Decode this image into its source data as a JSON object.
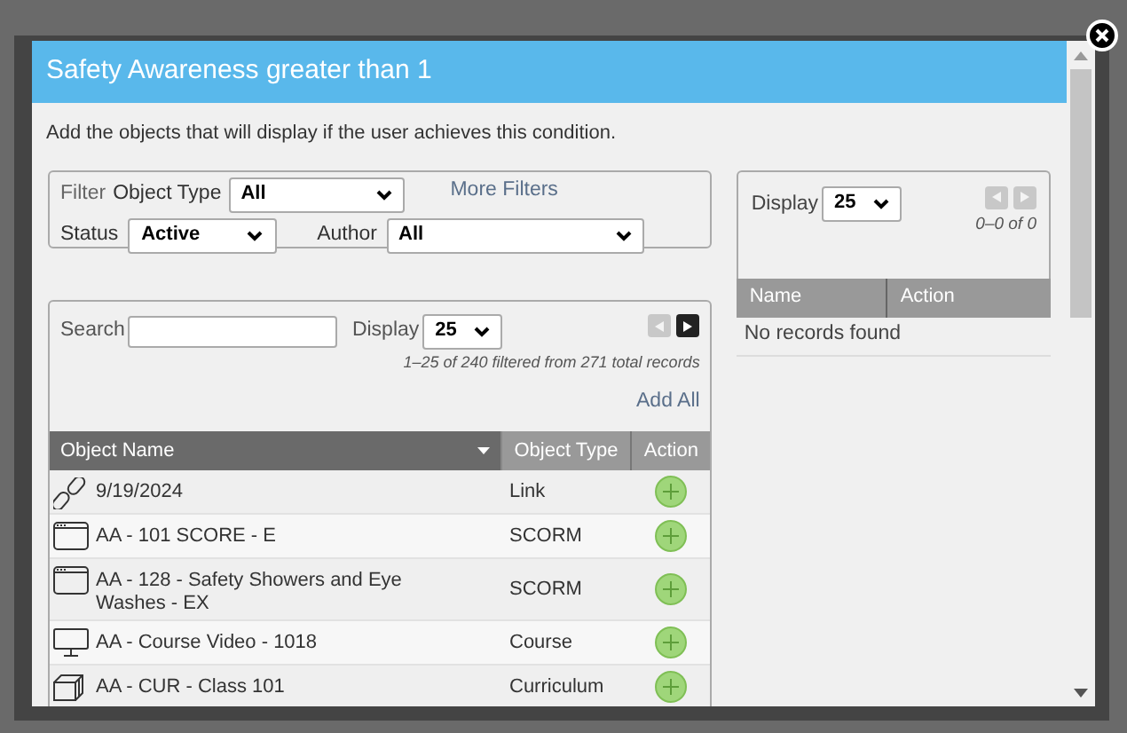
{
  "dialog": {
    "title": "Safety Awareness greater than 1",
    "description": "Add the objects that will display if the user achieves this condition."
  },
  "filters": {
    "label": "Filter",
    "object_type": {
      "label": "Object Type",
      "value": "All"
    },
    "more_filters": "More Filters",
    "status": {
      "label": "Status",
      "value": "Active"
    },
    "author": {
      "label": "Author",
      "value": "All"
    }
  },
  "available": {
    "search": {
      "label": "Search"
    },
    "display": {
      "label": "Display",
      "value": "25"
    },
    "pager": [
      {
        "kind": "prev",
        "disabled": true
      },
      {
        "kind": "next",
        "disabled": false
      }
    ],
    "summary": "1–25 of 240 filtered from 271 total records",
    "add_all": "Add All",
    "columns": [
      "Object Name",
      "Object Type",
      "Action"
    ],
    "rows": [
      {
        "kind": "link",
        "name": "9/19/2024",
        "type": "Link"
      },
      {
        "kind": "scorm",
        "name": "AA - 101 SCORE - E",
        "type": "SCORM"
      },
      {
        "kind": "scorm",
        "name": "AA - 128 - Safety Showers and Eye Washes - EX",
        "type": "SCORM"
      },
      {
        "kind": "course",
        "name": "AA - Course Video - 1018",
        "type": "Course"
      },
      {
        "kind": "curriculum",
        "name": "AA - CUR - Class 101",
        "type": "Curriculum"
      }
    ]
  },
  "selected": {
    "display": {
      "label": "Display",
      "value": "25"
    },
    "pager": [
      {
        "kind": "prev",
        "disabled": true
      },
      {
        "kind": "next",
        "disabled": true
      }
    ],
    "summary": "0–0 of 0",
    "columns": [
      "Name",
      "Action"
    ],
    "empty": "No records found"
  }
}
